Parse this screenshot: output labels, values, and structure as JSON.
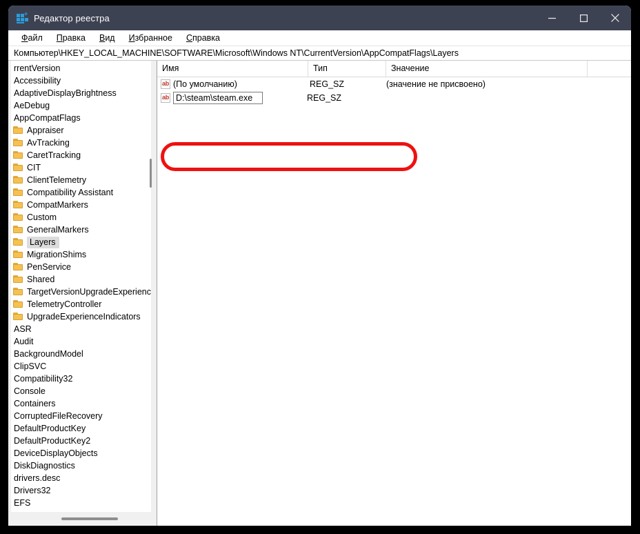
{
  "window": {
    "title": "Редактор реестра",
    "icon": "registry-editor-icon",
    "controls": {
      "minimize": "minimize-icon",
      "maximize": "maximize-icon",
      "close": "close-icon"
    },
    "titlebar_color": "#3d4253"
  },
  "menubar": {
    "items": [
      {
        "accel": "Ф",
        "rest": "айл"
      },
      {
        "accel": "П",
        "rest": "равка"
      },
      {
        "accel": "В",
        "rest": "ид"
      },
      {
        "accel": "И",
        "rest": "збранное"
      },
      {
        "accel": "С",
        "rest": "правка"
      }
    ]
  },
  "address": {
    "path": "Компьютер\\HKEY_LOCAL_MACHINE\\SOFTWARE\\Microsoft\\Windows NT\\CurrentVersion\\AppCompatFlags\\Layers"
  },
  "tree": {
    "items": [
      {
        "label": "rrentVersion",
        "folder": false,
        "selected": false,
        "clipped": true
      },
      {
        "label": "Accessibility",
        "folder": false,
        "selected": false
      },
      {
        "label": "AdaptiveDisplayBrightness",
        "folder": false,
        "selected": false
      },
      {
        "label": "AeDebug",
        "folder": false,
        "selected": false
      },
      {
        "label": "AppCompatFlags",
        "folder": false,
        "selected": false
      },
      {
        "label": "Appraiser",
        "folder": true,
        "selected": false
      },
      {
        "label": "AvTracking",
        "folder": true,
        "selected": false
      },
      {
        "label": "CaretTracking",
        "folder": true,
        "selected": false
      },
      {
        "label": "CIT",
        "folder": true,
        "selected": false
      },
      {
        "label": "ClientTelemetry",
        "folder": true,
        "selected": false
      },
      {
        "label": "Compatibility Assistant",
        "folder": true,
        "selected": false
      },
      {
        "label": "CompatMarkers",
        "folder": true,
        "selected": false
      },
      {
        "label": "Custom",
        "folder": true,
        "selected": false
      },
      {
        "label": "GeneralMarkers",
        "folder": true,
        "selected": false
      },
      {
        "label": "Layers",
        "folder": true,
        "selected": true
      },
      {
        "label": "MigrationShims",
        "folder": true,
        "selected": false
      },
      {
        "label": "PenService",
        "folder": true,
        "selected": false
      },
      {
        "label": "Shared",
        "folder": true,
        "selected": false
      },
      {
        "label": "TargetVersionUpgradeExperienceIn",
        "folder": true,
        "selected": false
      },
      {
        "label": "TelemetryController",
        "folder": true,
        "selected": false
      },
      {
        "label": "UpgradeExperienceIndicators",
        "folder": true,
        "selected": false
      },
      {
        "label": "ASR",
        "folder": false,
        "selected": false
      },
      {
        "label": "Audit",
        "folder": false,
        "selected": false
      },
      {
        "label": "BackgroundModel",
        "folder": false,
        "selected": false
      },
      {
        "label": "ClipSVC",
        "folder": false,
        "selected": false
      },
      {
        "label": "Compatibility32",
        "folder": false,
        "selected": false
      },
      {
        "label": "Console",
        "folder": false,
        "selected": false
      },
      {
        "label": "Containers",
        "folder": false,
        "selected": false
      },
      {
        "label": "CorruptedFileRecovery",
        "folder": false,
        "selected": false
      },
      {
        "label": "DefaultProductKey",
        "folder": false,
        "selected": false
      },
      {
        "label": "DefaultProductKey2",
        "folder": false,
        "selected": false
      },
      {
        "label": "DeviceDisplayObjects",
        "folder": false,
        "selected": false
      },
      {
        "label": "DiskDiagnostics",
        "folder": false,
        "selected": false
      },
      {
        "label": "drivers.desc",
        "folder": false,
        "selected": false
      },
      {
        "label": "Drivers32",
        "folder": false,
        "selected": false
      },
      {
        "label": "EFS",
        "folder": false,
        "selected": false
      }
    ]
  },
  "list": {
    "columns": [
      "Имя",
      "Тип",
      "Значение",
      ""
    ],
    "rows": [
      {
        "icon": "string-value-icon",
        "name": "(По умолчанию)",
        "type": "REG_SZ",
        "value": "(значение не присвоено)",
        "editing": false
      },
      {
        "icon": "string-value-icon",
        "name": "D:\\steam\\steam.exe",
        "type": "REG_SZ",
        "value": "",
        "editing": true
      }
    ]
  },
  "annotation": {
    "color": "#ee1111",
    "shape": "rounded-rectangle-highlight"
  }
}
